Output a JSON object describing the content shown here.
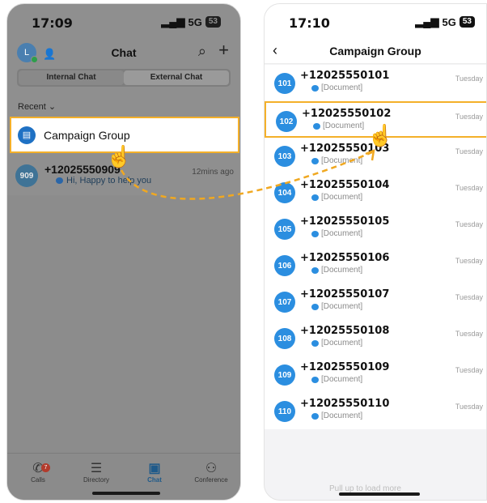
{
  "left": {
    "time": "17:09",
    "signal": "5G",
    "battery": "53",
    "avatar_letter": "L",
    "title": "Chat",
    "tabs": [
      "Internal Chat",
      "External Chat"
    ],
    "recent_label": "Recent ⌄",
    "campaign_group": "Campaign Group",
    "chat": {
      "avatar": "909",
      "name": "+12025550909",
      "preview": "Hi, Happy to help you",
      "time": "12mins ago"
    },
    "nav": [
      {
        "label": "Calls",
        "badge": "7"
      },
      {
        "label": "Directory"
      },
      {
        "label": "Chat"
      },
      {
        "label": "Conference"
      }
    ]
  },
  "right": {
    "time": "17:10",
    "signal": "5G",
    "battery": "53",
    "title": "Campaign Group",
    "rows": [
      {
        "avatar": "101",
        "name": "+12025550101",
        "preview": "[Document]",
        "time": "Tuesday"
      },
      {
        "avatar": "102",
        "name": "+12025550102",
        "preview": "[Document]",
        "time": "Tuesday"
      },
      {
        "avatar": "103",
        "name": "+12025550103",
        "preview": "[Document]",
        "time": "Tuesday"
      },
      {
        "avatar": "104",
        "name": "+12025550104",
        "preview": "[Document]",
        "time": "Tuesday"
      },
      {
        "avatar": "105",
        "name": "+12025550105",
        "preview": "[Document]",
        "time": "Tuesday"
      },
      {
        "avatar": "106",
        "name": "+12025550106",
        "preview": "[Document]",
        "time": "Tuesday"
      },
      {
        "avatar": "107",
        "name": "+12025550107",
        "preview": "[Document]",
        "time": "Tuesday"
      },
      {
        "avatar": "108",
        "name": "+12025550108",
        "preview": "[Document]",
        "time": "Tuesday"
      },
      {
        "avatar": "109",
        "name": "+12025550109",
        "preview": "[Document]",
        "time": "Tuesday"
      },
      {
        "avatar": "110",
        "name": "+12025550110",
        "preview": "[Document]",
        "time": "Tuesday"
      }
    ],
    "pull_hint": "Pull up to load more"
  },
  "colors": {
    "highlight": "#f4b02a",
    "accent": "#2b8ee0",
    "arrow": "#f0a821"
  }
}
